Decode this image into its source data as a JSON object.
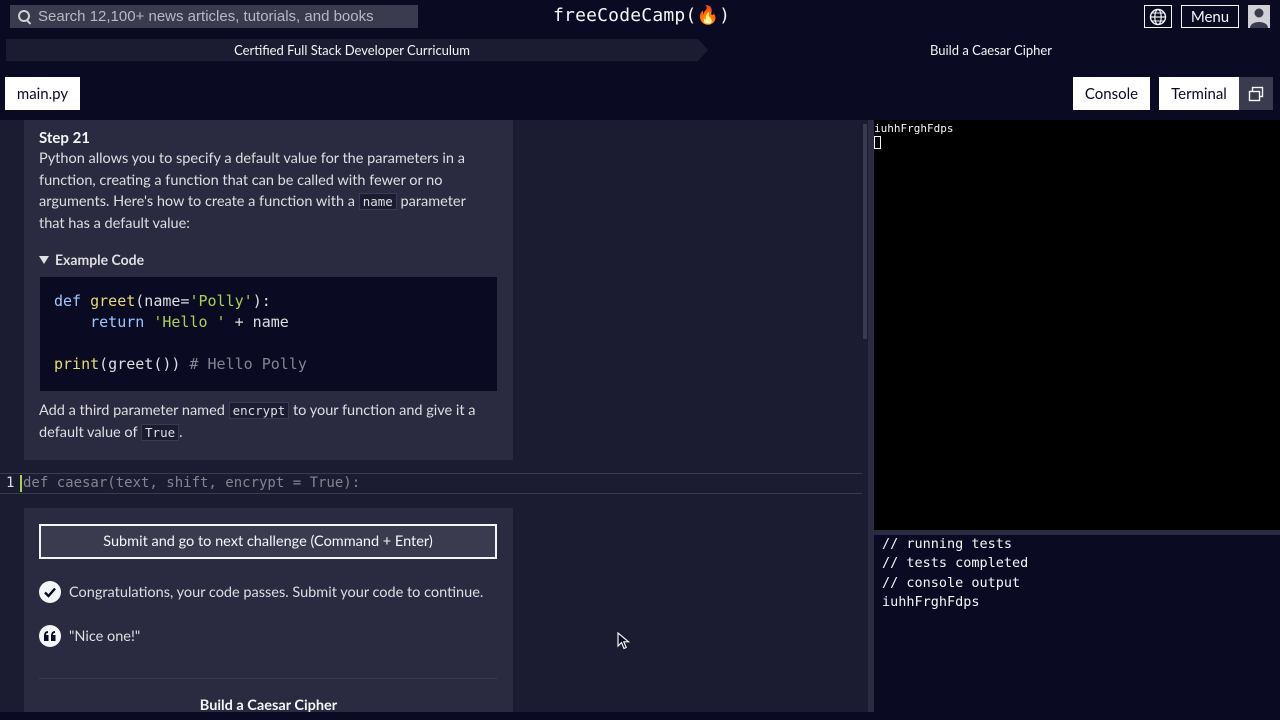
{
  "nav": {
    "search_placeholder": "Search 12,100+ news articles, tutorials, and books",
    "brand": "freeCodeCamp(🔥)",
    "menu_label": "Menu"
  },
  "breadcrumb": {
    "curriculum": "Certified Full Stack Developer Curriculum",
    "project": "Build a Caesar Cipher"
  },
  "tabs": {
    "file": "main.py",
    "console": "Console",
    "terminal": "Terminal"
  },
  "instructions": {
    "step": "Step 21",
    "p1_part1": "Python allows you to specify a default value for the parameters in a function, creating a function that can be called with fewer or no arguments. Here's how to create a function with a ",
    "p1_code": "name",
    "p1_part2": " parameter that has a default value:",
    "details_label": "Example Code",
    "p2_part1": "Add a third parameter named ",
    "p2_code1": "encrypt",
    "p2_part2": " to your function and give it a default value of ",
    "p2_code2": "True",
    "p2_part3": "."
  },
  "example_code": {
    "l1_kw": "def",
    "l1_fn": "greet",
    "l1_rest": "(name=",
    "l1_str": "'Polly'",
    "l1_end": "):",
    "l2_kw": "return",
    "l2_str": "'Hello '",
    "l2_rest": " + name",
    "l3_fn": "print",
    "l3_rest": "(greet()) ",
    "l3_cm": "# Hello Polly"
  },
  "editor": {
    "line_number": "1",
    "code": "def caesar(text, shift, encrypt = True):"
  },
  "actions": {
    "submit_label": "Submit and go to next challenge (Command + Enter)",
    "pass_message": "Congratulations, your code passes. Submit your code to continue.",
    "praise": "\"Nice one!\"",
    "footer_title": "Build a Caesar Cipher"
  },
  "terminal": {
    "output": "iuhhFrghFdps"
  },
  "console": {
    "lines": [
      "// running tests",
      "// tests completed",
      "// console output",
      "iuhhFrghFdps"
    ]
  }
}
